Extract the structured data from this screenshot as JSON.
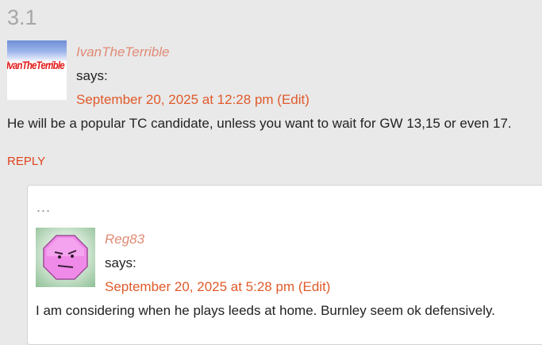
{
  "comment": {
    "number": "3.1",
    "avatar_text": "IvanTheTerrible",
    "author": "IvanTheTerrible",
    "says": "says:",
    "date": "September 20, 2025 at 12:28 pm",
    "edit": "(Edit)",
    "text": "He will be a popular TC candidate, unless you want to wait for GW 13,15 or even 17.",
    "reply": "REPLY"
  },
  "reply_comment": {
    "ellipsis": "...",
    "author": "Reg83",
    "says": "says:",
    "date": "September 20, 2025 at 5:28 pm",
    "edit": "(Edit)",
    "text": "I am considering when he plays leeds at home. Burnley seem ok defensively."
  },
  "colors": {
    "background": "#e9e9e9",
    "link": "#e05a2a",
    "author": "#e08a74",
    "reply": "#e0421c",
    "avatar2_face": "#f08ae8"
  },
  "icons": {
    "avatar1": "ivantheterrible-avatar",
    "avatar2": "pink-octagon-face-avatar"
  }
}
